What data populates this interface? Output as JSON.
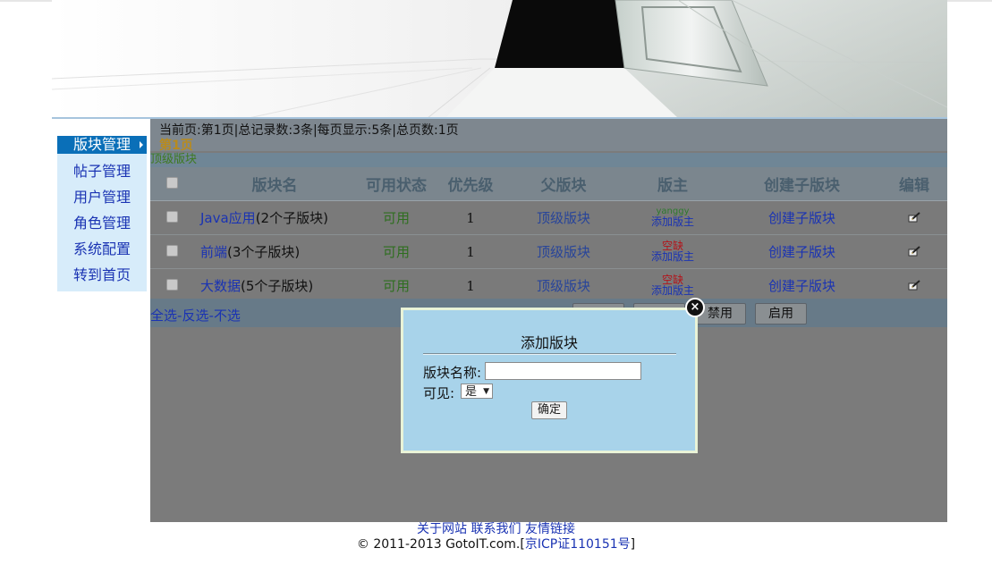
{
  "sidebar": {
    "items": [
      {
        "label": "版块管理",
        "active": true
      },
      {
        "label": "帖子管理"
      },
      {
        "label": "用户管理"
      },
      {
        "label": "角色管理"
      },
      {
        "label": "系统配置"
      },
      {
        "label": "转到首页"
      }
    ]
  },
  "pagination": {
    "info": "当前页:第1页|总记录数:3条|每页显示:5条|总页数:1页",
    "current": "第1页"
  },
  "section_title": "顶级版块",
  "table": {
    "headers": [
      "版块名",
      "可用状态",
      "优先级",
      "父版块",
      "版主",
      "创建子版块",
      "编辑"
    ],
    "rows": [
      {
        "name": "Java应用",
        "sub": "(2个子版块)",
        "status": "可用",
        "priority": "1",
        "parent": "顶级版块",
        "owner": "yanggy",
        "owner_add": "添加版主",
        "create": "创建子版块"
      },
      {
        "name": "前端",
        "sub": "(3个子版块)",
        "status": "可用",
        "priority": "1",
        "parent": "顶级版块",
        "owner_empty": "空缺",
        "owner_add": "添加版主",
        "create": "创建子版块"
      },
      {
        "name": "大数据",
        "sub": "(5个子版块)",
        "status": "可用",
        "priority": "1",
        "parent": "顶级版块",
        "owner_empty": "空缺",
        "owner_add": "添加版主",
        "create": "创建子版块"
      }
    ]
  },
  "selection": {
    "all": "全选",
    "sep": "-",
    "invert": "反选",
    "none": "不选"
  },
  "buttons": {
    "disable": "禁用",
    "enable": "启用"
  },
  "dialog": {
    "title": "添加版块",
    "name_label": "版块名称:",
    "name_value": "",
    "visible_label": "可见:",
    "visible_value": "是",
    "confirm": "确定"
  },
  "footer": {
    "links": [
      "关于网站",
      "联系我们",
      "友情链接"
    ],
    "copy_prefix": "© 2011-2013 GotoIT.com.[",
    "icp_text": "京ICP证110151号",
    "copy_suffix": "]"
  }
}
